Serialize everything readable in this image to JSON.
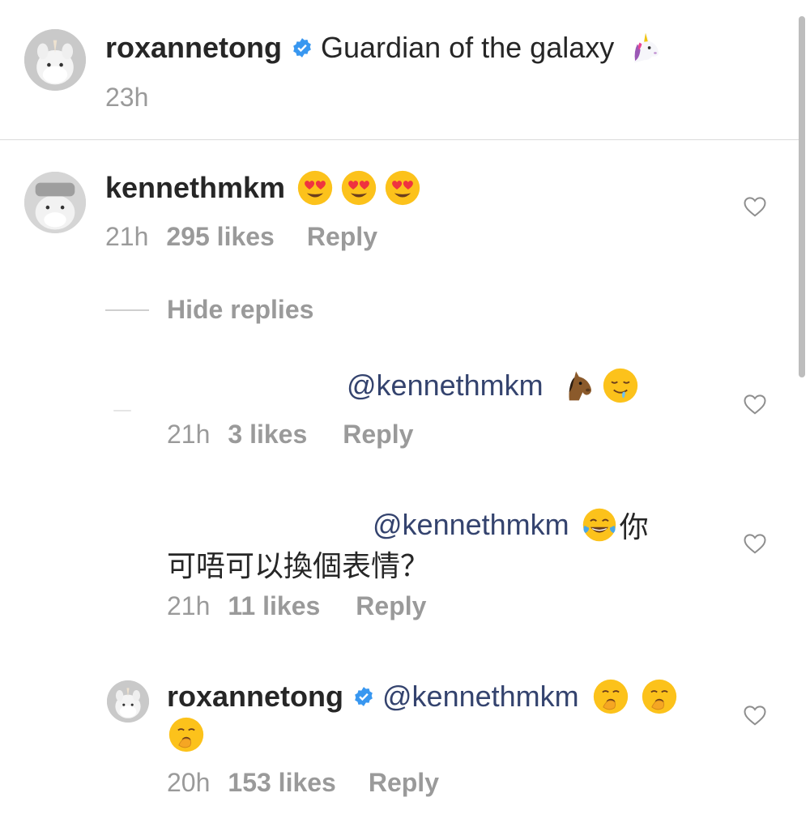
{
  "post": {
    "username": "roxannetong",
    "caption": "Guardian of the galaxy",
    "caption_emoji": "unicorn-emoji",
    "time": "23h"
  },
  "comment": {
    "username": "kennethmkm",
    "emojis": [
      "heart-eyes-emoji",
      "heart-eyes-emoji",
      "heart-eyes-emoji"
    ],
    "time": "21h",
    "likes": "295 likes",
    "reply_label": "Reply",
    "hide_replies_label": "Hide replies"
  },
  "replies": [
    {
      "mention": "@kennethmkm",
      "emojis": [
        "horse-face-emoji",
        "drooling-face-emoji"
      ],
      "time": "21h",
      "likes": "3 likes",
      "reply_label": "Reply"
    },
    {
      "mention": "@kennethmkm",
      "emoji": "tears-of-joy-emoji",
      "text_line1": "你",
      "text_line2": "可唔可以換個表情？",
      "time": "21h",
      "likes": "11 likes",
      "reply_label": "Reply"
    },
    {
      "username": "roxannetong",
      "mention": "@kennethmkm",
      "emojis": [
        "yawning-face-emoji",
        "yawning-face-emoji",
        "yawning-face-emoji"
      ],
      "time": "20h",
      "likes": "153 likes",
      "reply_label": "Reply"
    }
  ],
  "colors": {
    "mention": "#34436e",
    "verified": "#3897f0",
    "meta": "#9a9a9a",
    "divider": "#dbdbdb"
  }
}
